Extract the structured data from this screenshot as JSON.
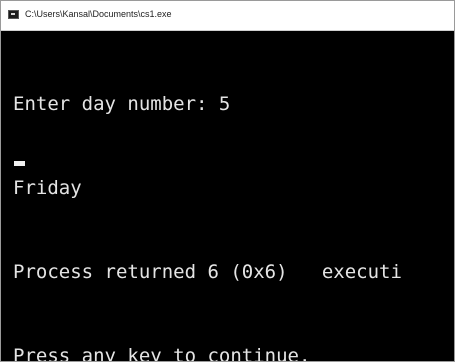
{
  "window": {
    "title": "C:\\Users\\Kansal\\Documents\\cs1.exe"
  },
  "console": {
    "lines": [
      "Enter day number: 5",
      "Friday",
      "Process returned 6 (0x6)   executi",
      "Press any key to continue."
    ]
  }
}
